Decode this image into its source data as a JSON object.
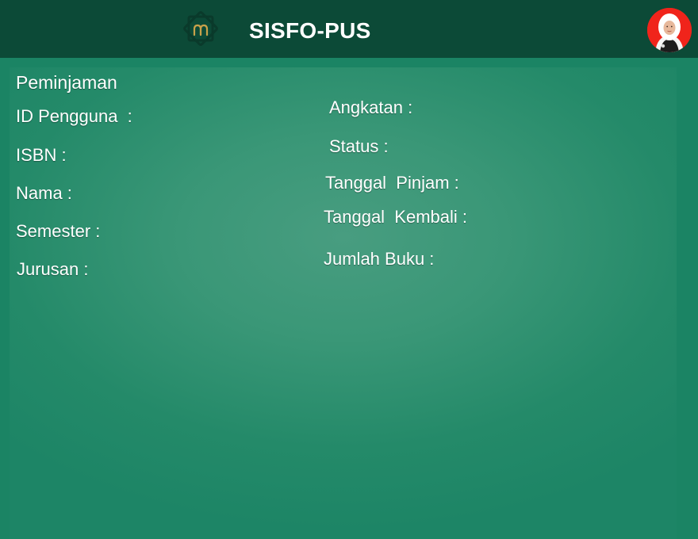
{
  "header": {
    "title": "SISFO-PUS",
    "logo_icon": "library-logo-icon",
    "avatar_icon": "user-avatar",
    "background": "#0c4a37"
  },
  "form": {
    "title": "Peminjaman",
    "fields": {
      "id_pengguna": "ID Pengguna  :",
      "isbn": "ISBN :",
      "nama": "Nama :",
      "semester": "Semester :",
      "jurusan": "Jurusan :",
      "angkatan": "Angkatan :",
      "status": "Status :",
      "tanggal_pinjam": "Tanggal  Pinjam :",
      "tanggal_kembali": "Tanggal  Kembali :",
      "jumlah_buku": "Jumlah Buku :"
    }
  },
  "colors": {
    "header": "#0c4a37",
    "page": "#1b8464",
    "panel_center": "#489d80",
    "avatar_bg": "#f0241b",
    "logo_accent": "#c9a24a"
  }
}
